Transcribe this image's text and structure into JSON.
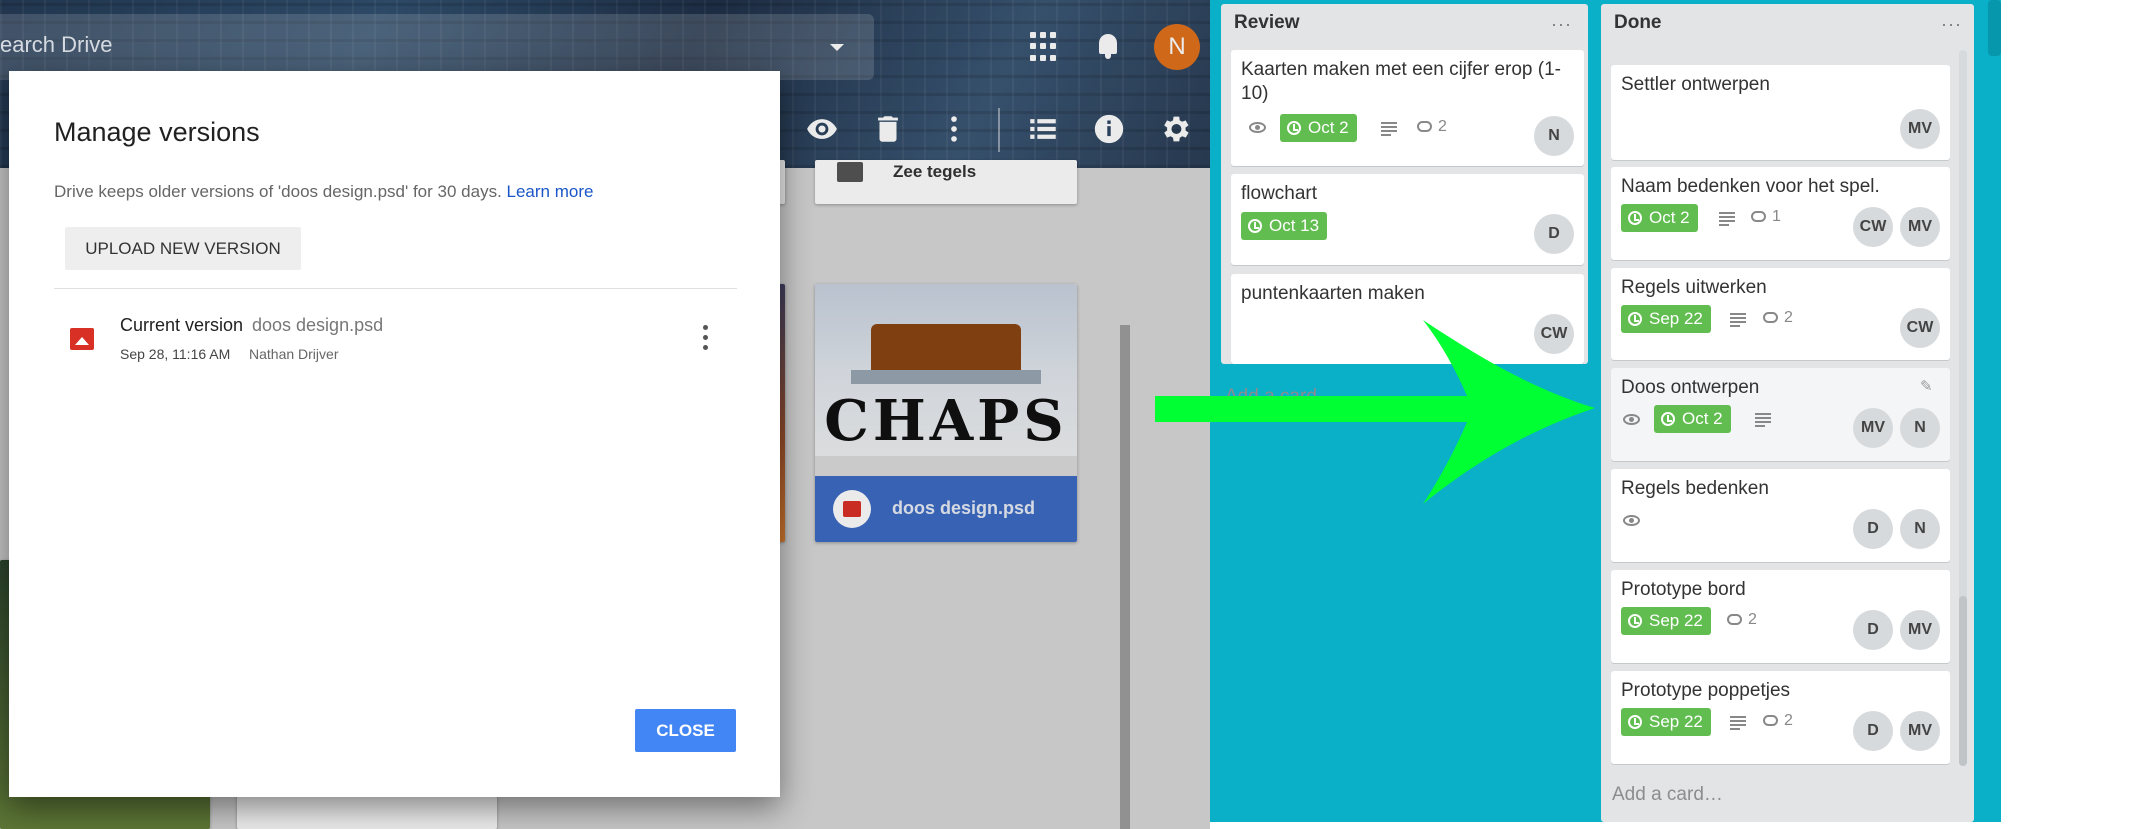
{
  "drive": {
    "search_placeholder": "earch Drive",
    "avatar_letter": "N",
    "files": [
      {
        "name": "Zee tegels"
      },
      {
        "name": "doos design.psd"
      }
    ]
  },
  "dialog": {
    "title": "Manage versions",
    "description": "Drive keeps older versions of 'doos design.psd' for 30 days. ",
    "learn_more": "Learn more",
    "upload_label": "UPLOAD NEW VERSION",
    "version": {
      "label": "Current version",
      "file": "doos design.psd",
      "date": "Sep 28, 11:16 AM",
      "user": "Nathan Drijver"
    },
    "close_label": "CLOSE"
  },
  "trello": {
    "colors": {
      "board": "#0aafc8",
      "due_green": "#61bd4f",
      "arrow": "#00ff33"
    },
    "review": {
      "title": "Review",
      "menu": "···",
      "cards": [
        {
          "title": "Kaarten maken met een cijfer erop (1-",
          "title2": "10)",
          "due": "Oct 2",
          "comments": "2",
          "members": [
            "N"
          ]
        },
        {
          "title": "flowchart",
          "due": "Oct 13",
          "members": [
            "D"
          ]
        },
        {
          "title": "puntenkaarten maken",
          "members": [
            "CW"
          ]
        }
      ],
      "add_card": "Add a card…"
    },
    "done": {
      "title": "Done",
      "menu": "···",
      "cards": [
        {
          "title": "Settler ontwerpen",
          "members": [
            "MV"
          ]
        },
        {
          "title": "Naam bedenken voor het spel.",
          "due": "Oct 2",
          "comments": "1",
          "members": [
            "CW",
            "MV"
          ]
        },
        {
          "title": "Regels uitwerken",
          "due": "Sep 22",
          "comments": "2",
          "members": [
            "CW"
          ]
        },
        {
          "title": "Doos ontwerpen",
          "due": "Oct 2",
          "members": [
            "MV",
            "N"
          ]
        },
        {
          "title": "Regels bedenken",
          "members": [
            "D",
            "N"
          ]
        },
        {
          "title": "Prototype bord",
          "due": "Sep 22",
          "comments": "2",
          "members": [
            "D",
            "MV"
          ]
        },
        {
          "title": "Prototype poppetjes",
          "due": "Sep 22",
          "comments": "2",
          "members": [
            "D",
            "MV"
          ]
        }
      ],
      "add_card": "Add a card…"
    }
  },
  "logo_text": "CHAPS"
}
